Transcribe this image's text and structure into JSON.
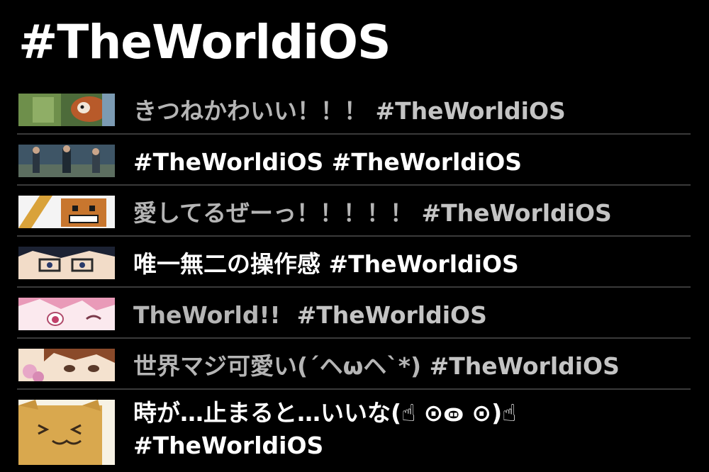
{
  "header": {
    "title": "#TheWorldiOS"
  },
  "tweets": [
    {
      "avatar_icon": "red-panda-photo",
      "text": "きつねかわいい！！！",
      "hashtag": "#TheWorldiOS",
      "tone": "dim"
    },
    {
      "avatar_icon": "people-crowd-photo",
      "text": "",
      "hashtag": "#TheWorldiOS #TheWorldiOS",
      "tone": "bright"
    },
    {
      "avatar_icon": "cartoon-monster-avatar",
      "text": "愛してるぜーっ！！！！！",
      "hashtag": "#TheWorldiOS",
      "tone": "dim"
    },
    {
      "avatar_icon": "anime-glasses-avatar",
      "text": "唯一無二の操作感",
      "hashtag": "#TheWorldiOS",
      "tone": "bright"
    },
    {
      "avatar_icon": "anime-pink-hair-avatar",
      "text": "TheWorld!!",
      "hashtag": "#TheWorldiOS",
      "tone": "dim"
    },
    {
      "avatar_icon": "anime-brown-hair-avatar",
      "text": "世界マジ可愛い(´ヘωヘ`*)",
      "hashtag": "#TheWorldiOS",
      "tone": "dim"
    },
    {
      "avatar_icon": "cat-block-avatar",
      "text": "時が…止まると…いいな(☝︎ ⊙ꙫ ⊙)☝︎",
      "hashtag": "#TheWorldiOS",
      "tone": "bright"
    }
  ],
  "colors": {
    "background": "#000000",
    "divider": "#3a3a3a",
    "text_bright": "#ffffff",
    "text_dim": "#b5b5b5"
  }
}
